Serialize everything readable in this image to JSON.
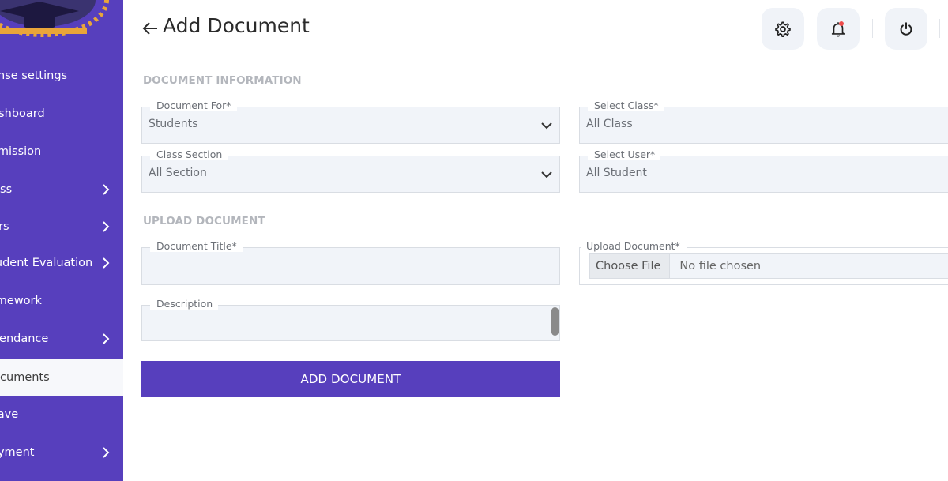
{
  "sidebar": {
    "items": [
      {
        "label": "License settings",
        "has_children": false,
        "active": false
      },
      {
        "label": "Dashboard",
        "has_children": false,
        "active": false
      },
      {
        "label": "Admission",
        "has_children": false,
        "active": false
      },
      {
        "label": "Class",
        "has_children": true,
        "active": false
      },
      {
        "label": "Users",
        "has_children": true,
        "active": false
      },
      {
        "label": "Student Evaluation",
        "has_children": true,
        "active": false
      },
      {
        "label": "Homework",
        "has_children": false,
        "active": false
      },
      {
        "label": "Attendance",
        "has_children": true,
        "active": false
      },
      {
        "label": "Documents",
        "has_children": false,
        "active": true
      },
      {
        "label": "Leave",
        "has_children": false,
        "active": false
      },
      {
        "label": "Payment",
        "has_children": true,
        "active": false
      }
    ]
  },
  "header": {
    "title": "Add Document",
    "settings_icon": "gear-icon",
    "notification_icon": "bell-icon",
    "logout_icon": "power-icon"
  },
  "document_info": {
    "section_title": "DOCUMENT INFORMATION",
    "document_for": {
      "label": "Document For*",
      "value": "Students"
    },
    "select_class": {
      "label": "Select Class*",
      "value": "All Class"
    },
    "class_section": {
      "label": "Class Section",
      "value": "All Section"
    },
    "select_user": {
      "label": "Select User*",
      "value": "All Student"
    }
  },
  "upload": {
    "section_title": "UPLOAD DOCUMENT",
    "document_title": {
      "label": "Document Title*",
      "value": ""
    },
    "description": {
      "label": "Description",
      "value": ""
    },
    "upload_document": {
      "label": "Upload Document*",
      "button": "Choose File",
      "status": "No file chosen"
    },
    "submit_label": "ADD DOCUMENT"
  },
  "colors": {
    "sidebar_bg": "#573fbd",
    "accent": "#573fbd",
    "field_bg": "#f1f4f9",
    "notification_dot": "#ef4b4b"
  }
}
